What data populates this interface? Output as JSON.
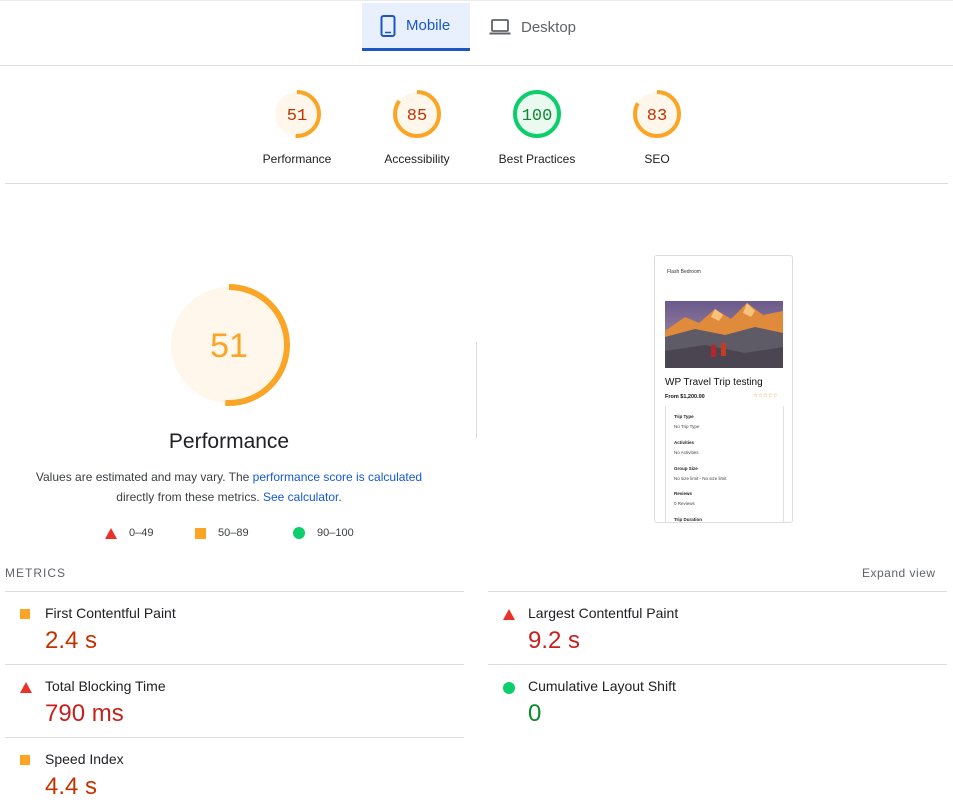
{
  "tabs": [
    {
      "label": "Mobile",
      "icon": "phone-icon",
      "active": true
    },
    {
      "label": "Desktop",
      "icon": "laptop-icon",
      "active": false
    }
  ],
  "scores": [
    {
      "value": "51",
      "label": "Performance",
      "level": "average",
      "fraction": 0.51
    },
    {
      "value": "85",
      "label": "Accessibility",
      "level": "average",
      "fraction": 0.85
    },
    {
      "value": "100",
      "label": "Best Practices",
      "level": "pass",
      "fraction": 1.0
    },
    {
      "value": "83",
      "label": "SEO",
      "level": "average",
      "fraction": 0.83
    }
  ],
  "performance": {
    "score": "51",
    "fraction": 0.51,
    "title": "Performance",
    "desc_prefix": "Values are estimated and may vary. The ",
    "desc_link1": "performance score is calculated",
    "desc_middle": "directly from these metrics. ",
    "desc_link2": "See calculator",
    "desc_suffix": "."
  },
  "legend": {
    "fail": "0–49",
    "average": "50–89",
    "pass": "90–100"
  },
  "screenshot": {
    "site_name": "Flash Bedroom",
    "trip_title": "WP Travel Trip testing",
    "price": "From $1,200.00",
    "stars": "☆☆☆☆☆",
    "fields": [
      {
        "label": "Trip Type",
        "value": "No Trip Type"
      },
      {
        "label": "Activities",
        "value": "No Activities"
      },
      {
        "label": "Group Size",
        "value": "No size limit - No size limit"
      },
      {
        "label": "Reviews",
        "value": "0 Reviews"
      },
      {
        "label": "Trip Duration",
        "value": ""
      }
    ]
  },
  "metrics": {
    "heading": "METRICS",
    "expand": "Expand view",
    "items": [
      {
        "name": "First Contentful Paint",
        "value": "2.4 s",
        "level": "average"
      },
      {
        "name": "Largest Contentful Paint",
        "value": "9.2 s",
        "level": "fail"
      },
      {
        "name": "Total Blocking Time",
        "value": "790 ms",
        "level": "fail"
      },
      {
        "name": "Cumulative Layout Shift",
        "value": "0",
        "level": "pass"
      },
      {
        "name": "Speed Index",
        "value": "4.4 s",
        "level": "average"
      }
    ]
  },
  "colors": {
    "fail": "#e8332b",
    "average": "#fba526",
    "average_text": "#c33300",
    "pass": "#0cce6b",
    "pass_text": "#0d8a2e",
    "accent": "#1a56c4"
  }
}
